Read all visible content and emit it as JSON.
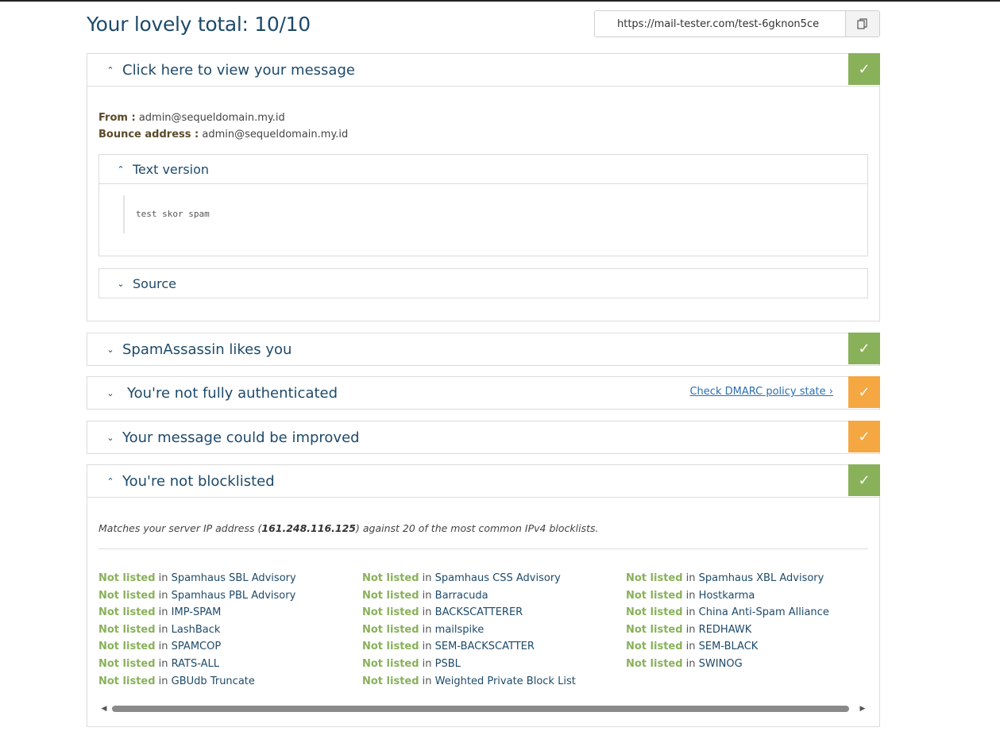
{
  "header": {
    "total": "Your lovely total: 10/10",
    "url": "https://mail-tester.com/test-6gknon5ce",
    "copy_icon": "copy-icon"
  },
  "colors": {
    "good": "#89b15a",
    "warn": "#f5a742",
    "title": "#1e4a6a",
    "link": "#2a6fb3"
  },
  "message_panel": {
    "title": "Click here to view your message",
    "status": "good",
    "from_label": "From :",
    "from_value": "admin@sequeldomain.my.id",
    "bounce_label": "Bounce address :",
    "bounce_value": "admin@sequeldomain.my.id",
    "text_version": {
      "title": "Text version",
      "content": "test skor spam"
    },
    "source": {
      "title": "Source"
    }
  },
  "panels": [
    {
      "title": "SpamAssassin likes you",
      "status": "good"
    },
    {
      "title": "You're not fully authenticated",
      "status": "warn",
      "link": "Check DMARC policy state ›"
    },
    {
      "title": "Your message could be improved",
      "status": "warn"
    }
  ],
  "blocklist": {
    "title": "You're not blocklisted",
    "status": "good",
    "desc_prefix": "Matches your server IP address (",
    "ip": "161.248.116.125",
    "desc_suffix": ") against 20 of the most common IPv4 blocklists.",
    "not_listed": "Not listed",
    "in": " in ",
    "columns": [
      [
        "Spamhaus SBL Advisory",
        "Spamhaus PBL Advisory",
        "IMP-SPAM",
        "LashBack",
        "SPAMCOP",
        "RATS-ALL",
        "GBUdb Truncate"
      ],
      [
        "Spamhaus CSS Advisory",
        "Barracuda",
        "BACKSCATTERER",
        "mailspike",
        "SEM-BACKSCATTER",
        "PSBL",
        "Weighted Private Block List"
      ],
      [
        "Spamhaus XBL Advisory",
        "Hostkarma",
        "China Anti-Spam Alliance",
        "REDHAWK",
        "SEM-BLACK",
        "SWINOG"
      ]
    ]
  }
}
